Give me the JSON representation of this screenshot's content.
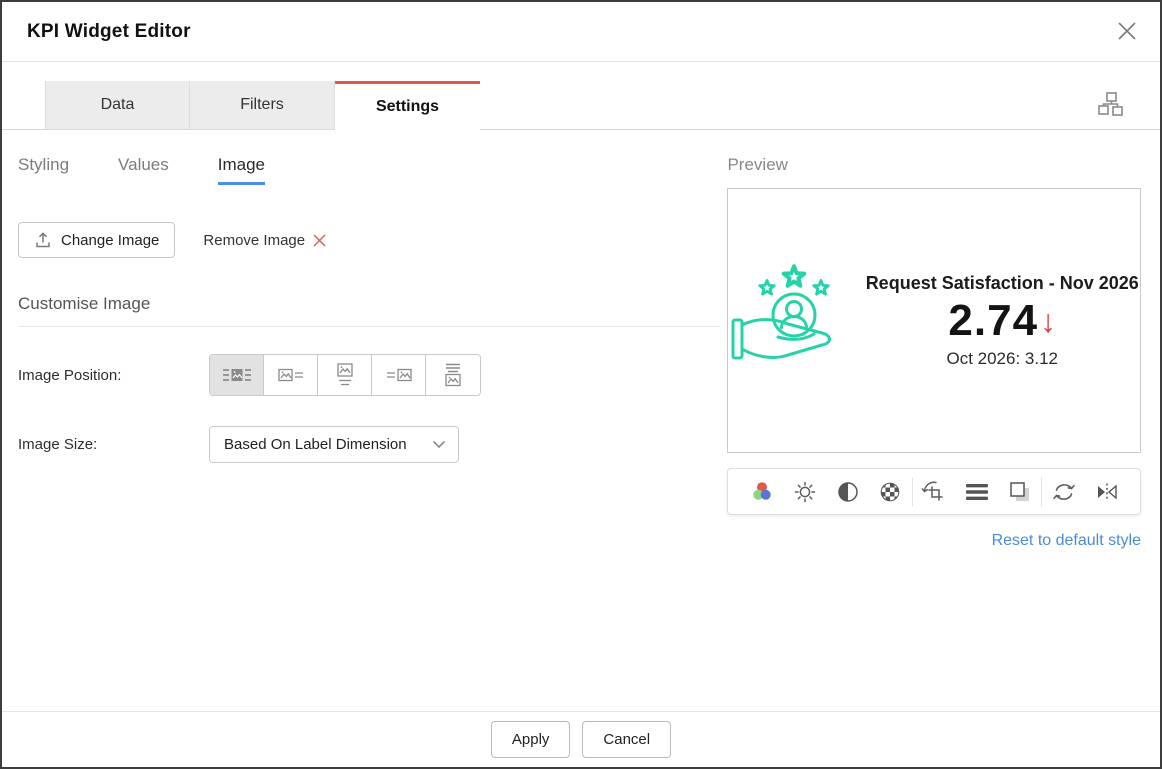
{
  "dialog": {
    "title": "KPI Widget Editor"
  },
  "tabs": {
    "items": [
      "Data",
      "Filters",
      "Settings"
    ],
    "active": "Settings"
  },
  "subtabs": {
    "items": [
      "Styling",
      "Values",
      "Image"
    ],
    "active": "Image"
  },
  "image_actions": {
    "change_image_label": "Change Image",
    "remove_image_label": "Remove Image"
  },
  "customise": {
    "heading": "Customise Image",
    "image_position_label": "Image Position:",
    "image_position_options": [
      "image-center-text-sides",
      "image-left-text-right",
      "image-top-text-bottom",
      "text-left-image-right",
      "text-top-image-bottom"
    ],
    "image_position_selected": 0,
    "image_size_label": "Image Size:",
    "image_size_value": "Based On Label Dimension"
  },
  "preview": {
    "label": "Preview",
    "kpi": {
      "title": "Request Satisfaction - Nov 2026",
      "value": "2.74",
      "trend": "down",
      "trend_arrow": "↓",
      "previous": "Oct 2026: 3.12"
    },
    "toolbar_icons": [
      "color-adjust",
      "brightness",
      "contrast",
      "texture",
      "crop-rotate",
      "line-thickness",
      "shadow",
      "reset-sync",
      "flip-horizontal"
    ],
    "reset_link": "Reset to default style"
  },
  "footer": {
    "apply_label": "Apply",
    "cancel_label": "Cancel"
  },
  "colors": {
    "tab_accent_red": "#e2574c",
    "link_blue": "#4a8bd5",
    "subtab_underline_blue": "#4a8fe0",
    "kpi_icon_teal": "#26d3a9",
    "trend_red": "#e23b3b",
    "remove_x_red": "#e2574c"
  }
}
